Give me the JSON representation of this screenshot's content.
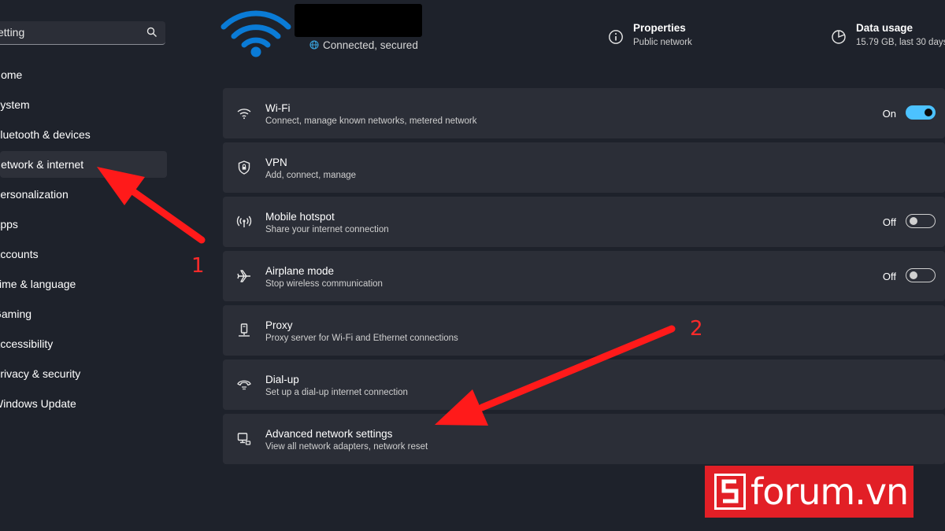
{
  "search": {
    "value": "setting"
  },
  "sidebar": {
    "items": [
      {
        "label": "Home"
      },
      {
        "label": "System"
      },
      {
        "label": "Bluetooth & devices"
      },
      {
        "label": "Network & internet",
        "active": true
      },
      {
        "label": "Personalization"
      },
      {
        "label": "Apps"
      },
      {
        "label": "Accounts"
      },
      {
        "label": "Time & language"
      },
      {
        "label": "Gaming"
      },
      {
        "label": "Accessibility"
      },
      {
        "label": "Privacy & security"
      },
      {
        "label": "Windows Update"
      }
    ]
  },
  "header": {
    "connection_status": "Connected, secured",
    "properties": {
      "title": "Properties",
      "subtitle": "Public network"
    },
    "data_usage": {
      "title": "Data usage",
      "subtitle": "15.79 GB, last 30 days"
    }
  },
  "settings": [
    {
      "title": "Wi-Fi",
      "subtitle": "Connect, manage known networks, metered network",
      "icon": "wifi-icon",
      "toggle": "On"
    },
    {
      "title": "VPN",
      "subtitle": "Add, connect, manage",
      "icon": "shield-icon"
    },
    {
      "title": "Mobile hotspot",
      "subtitle": "Share your internet connection",
      "icon": "hotspot-icon",
      "toggle": "Off"
    },
    {
      "title": "Airplane mode",
      "subtitle": "Stop wireless communication",
      "icon": "airplane-icon",
      "toggle": "Off"
    },
    {
      "title": "Proxy",
      "subtitle": "Proxy server for Wi-Fi and Ethernet connections",
      "icon": "proxy-icon"
    },
    {
      "title": "Dial-up",
      "subtitle": "Set up a dial-up internet connection",
      "icon": "dialup-icon"
    },
    {
      "title": "Advanced network settings",
      "subtitle": "View all network adapters, network reset",
      "icon": "monitor-icon"
    }
  ],
  "annotations": {
    "step1": "1",
    "step2": "2"
  },
  "watermark": {
    "brand": "forum.vn",
    "color": "#e21f26"
  },
  "colors": {
    "background": "#1e222b",
    "card": "#2b2e37",
    "accent": "#4cc2ff",
    "wifi_blue": "#0a7bd6",
    "arrow": "#ff1a1a"
  }
}
